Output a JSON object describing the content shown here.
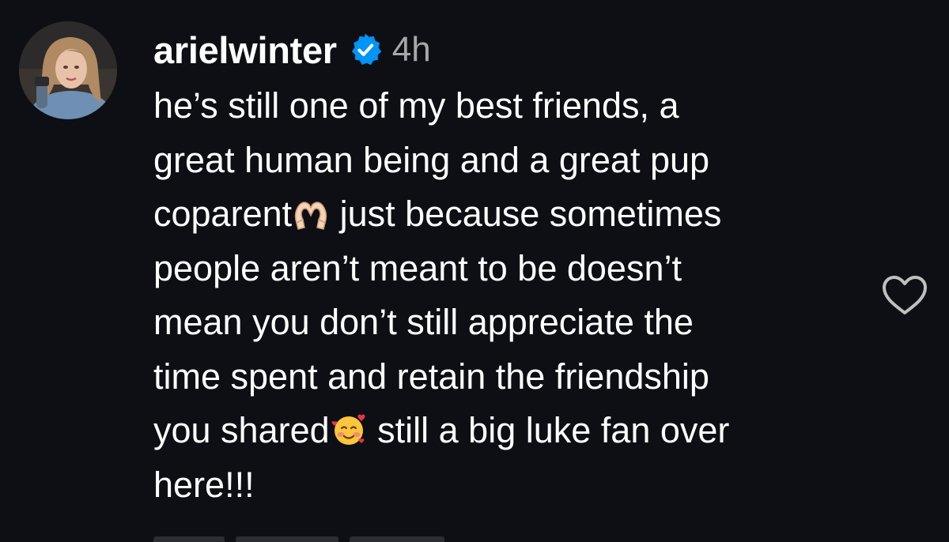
{
  "comment": {
    "username": "arielwinter",
    "verified": true,
    "timestamp": "4h",
    "lines": [
      {
        "text": "he’s still one of my best friends, a"
      },
      {
        "text": "great human being and a great pup"
      },
      {
        "before": "coparent",
        "emoji": "heart-hands-emoji",
        "after": " just because sometimes"
      },
      {
        "text": "people aren’t meant to be doesn’t"
      },
      {
        "text": "mean you don’t still appreciate the"
      },
      {
        "text": "time spent and retain the friendship"
      },
      {
        "before": "you shared",
        "emoji": "smiling-face-with-hearts-emoji",
        "after": " still a big luke fan over"
      },
      {
        "text": "here!!!"
      }
    ],
    "like_icon": "heart-outline-icon"
  },
  "colors": {
    "background": "#0d0f14",
    "text": "#ffffff",
    "muted": "#a8a8a8",
    "verified_badge": "#0095f6"
  }
}
